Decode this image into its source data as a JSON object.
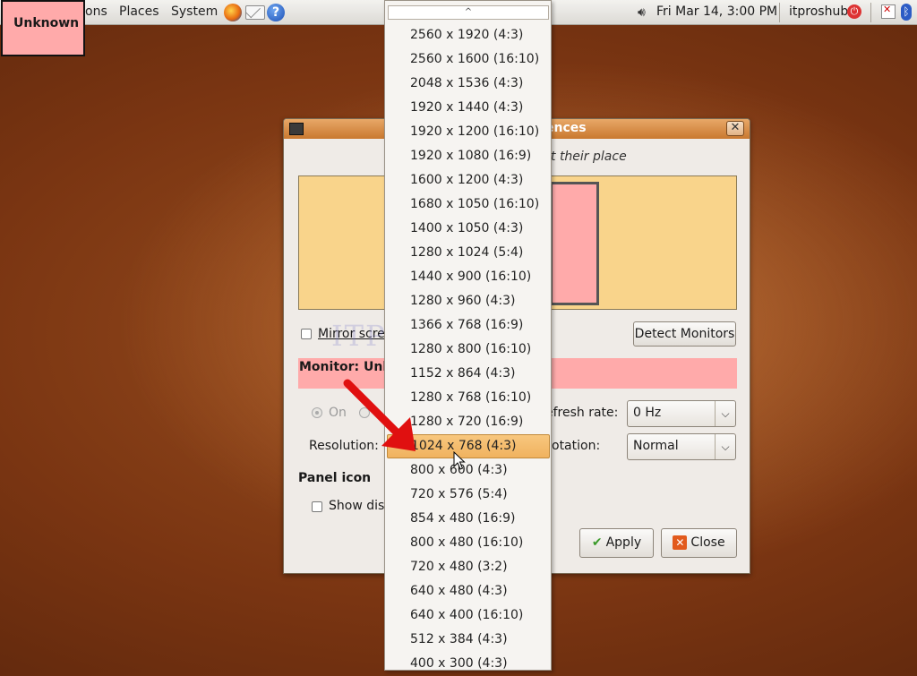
{
  "top_panel": {
    "menus": [
      "ons",
      "Places",
      "System"
    ],
    "clock": "Fri Mar 14,  3:00 PM",
    "user": "itproshub"
  },
  "overlay": {
    "unknown_label": "Unknown"
  },
  "dialog": {
    "title_fragment": "ences",
    "hint": "t their place",
    "mirror_label": "Mirror scree",
    "detect_button": "Detect Monitors",
    "monitor_heading": "Monitor: Unk",
    "on_label": "On",
    "refresh_label": "efresh rate:",
    "refresh_value": "0 Hz",
    "resolution_label": "Resolution:",
    "rotation_label": "otation:",
    "rotation_value": "Normal",
    "panel_icon_heading": "Panel icon",
    "show_display_label": "Show disp",
    "apply_button": "Apply",
    "close_button": "Close"
  },
  "watermark": "ITP  HUB",
  "dropdown": {
    "scroll_up_glyph": "^",
    "options": [
      "2560 x 1920 (4:3)",
      "2560 x 1600 (16:10)",
      "2048 x 1536 (4:3)",
      "1920 x 1440 (4:3)",
      "1920 x 1200 (16:10)",
      "1920 x 1080 (16:9)",
      "1600 x 1200 (4:3)",
      "1680 x 1050 (16:10)",
      "1400 x 1050 (4:3)",
      "1280 x 1024 (5:4)",
      "1440 x 900 (16:10)",
      "1280 x 960 (4:3)",
      "1366 x 768 (16:9)",
      "1280 x 800 (16:10)",
      "1152 x 864 (4:3)",
      "1280 x 768 (16:10)",
      "1280 x 720 (16:9)",
      "1024 x 768 (4:3)",
      "800 x 600 (4:3)",
      "720 x 576 (5:4)",
      "854 x 480 (16:9)",
      "800 x 480 (16:10)",
      "720 x 480 (3:2)",
      "640 x 480 (4:3)",
      "640 x 400 (16:10)",
      "512 x 384 (4:3)",
      "400 x 300 (4:3)"
    ],
    "selected": "1024 x 768 (4:3)"
  },
  "colors": {
    "unknown_fill": "#ffaaaa",
    "monitor_canvas": "#f9d48b",
    "selection": "#f0b25f",
    "title_bar": "#c9782f",
    "arrow": "#e01010"
  }
}
